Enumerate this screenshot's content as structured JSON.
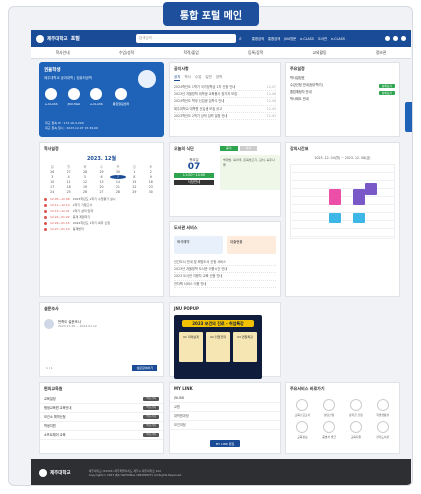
{
  "banner": {
    "title": "통합 포털 메인"
  },
  "topbar": {
    "logo": "제주대학교",
    "portal": "포털",
    "search_placeholder": "검색입력",
    "links": [
      "통합검색",
      "통합검색",
      "JNU영문",
      "e-CLASS",
      "도서관",
      "e-CLASS"
    ]
  },
  "menu": [
    "학사안내",
    "수업/성적",
    "학적/졸업",
    "등록/장학",
    "교외활동",
    "정보관"
  ],
  "profile": {
    "name": "권율학생",
    "dept": "제주대학교 공과대학 | 컴퓨터공학",
    "quick": [
      "e-CLASS",
      "JNU-Mail",
      "e-CLASS",
      "통합알림센터"
    ],
    "info": [
      "최근 접속 IP : 172.16.4.209",
      "최근 접속 일시 : 2023.12.07 15:39:06"
    ]
  },
  "notice": {
    "title": "공지사항",
    "tabs": [
      "공지",
      "학사",
      "수업",
      "일반",
      "장학"
    ],
    "items": [
      {
        "text": "2024학년도 1학기 국가장학금 1차 신청 안내",
        "date": "12-07"
      },
      {
        "text": "2023년 겨울방학 대학생 교육봉사 참가자 모집",
        "date": "12-06"
      },
      {
        "text": "2024학년도 학부 신입생 입학식 안내",
        "date": "12-06"
      },
      {
        "text": "제주대학교 대학원 신입생 모집 공고",
        "date": "12-05"
      },
      {
        "text": "2023학년도 2학기 성적 입력 일정 안내",
        "date": "12-05"
      }
    ]
  },
  "schedule": {
    "title": "주요일정",
    "items": [
      {
        "label": "학사일정표",
        "badge": ""
      },
      {
        "label": "수강신청 안내(정규학기)",
        "badge": "상세보기"
      },
      {
        "label": "졸업예정자 안내",
        "badge": "상세보기"
      },
      {
        "label": "학사제도 안내",
        "badge": ""
      }
    ]
  },
  "calendar": {
    "title": "학사일정",
    "month": "2023. 12월",
    "days": [
      "일",
      "월",
      "화",
      "수",
      "목",
      "금",
      "토"
    ],
    "dates": [
      "26",
      "27",
      "28",
      "29",
      "30",
      "1",
      "2",
      "3",
      "4",
      "5",
      "6",
      "7",
      "8",
      "9",
      "10",
      "11",
      "12",
      "13",
      "14",
      "15",
      "16",
      "17",
      "18",
      "19",
      "20",
      "21",
      "22",
      "23",
      "24",
      "25",
      "26",
      "27",
      "28",
      "29",
      "30"
    ],
    "today": "7",
    "events": [
      {
        "date": "12.05~12.08",
        "text": "2023학년도 2학기 수업평가 실시"
      },
      {
        "date": "12.11~12.14",
        "text": "2학기 기말고사"
      },
      {
        "date": "12.15~12.21",
        "text": "2학기 성적 입력"
      },
      {
        "date": "12.22~01.02",
        "text": "동계 계절학기"
      },
      {
        "date": "12.26~01.15",
        "text": "2024학년도 1학기 복학 신청"
      },
      {
        "date": "12.27~01.10",
        "text": "동계방학"
      }
    ]
  },
  "meal": {
    "title": "오늘의 식단",
    "tabs": [
      "중식",
      "석식"
    ],
    "day": "07",
    "weekday": "목요일",
    "time": "11:00~14:00",
    "menu": "백미밥, 북어국, 돈육불고기, 김치, 숙주나물",
    "button": "식당안내"
  },
  "library": {
    "title": "도서관 서비스",
    "cards": [
      "좌석예약",
      "대출현황"
    ],
    "items": [
      "신간도서 안내 및 희망도서 신청 서비스",
      "2023년 겨울방학 도서관 이용시간 안내",
      "2023 도서관 이용자 교육 신청 안내",
      "전자책 서비스 이용 안내"
    ]
  },
  "timetable": {
    "title": "강의시간표",
    "range": "2023. 12. 04(월) ~ 2023. 12. 08(금)"
  },
  "survey": {
    "title": "설문조사",
    "item": "만족도 설문조사",
    "period": "2023.11.28 ~ 2024.01.12",
    "pager": "1 / 1",
    "button": "설문참여하기"
  },
  "popup": {
    "title": "JNU POPUP",
    "headline": "2023 보건의 진로 - 취업특강",
    "cards": [
      "01 미래설계",
      "02 취업전략",
      "03 면접특강"
    ]
  },
  "quicklinks": {
    "title": "편의교육원",
    "items": [
      "교육일정",
      "평생교육원 교육안내",
      "보건소 예약신청",
      "학생지원",
      "소프트웨어 교육"
    ],
    "pill": "바로가기"
  },
  "mylink": {
    "title": "MY LINK",
    "items": [
      "JNUBB",
      "교원",
      "대학원과정",
      "보건과정"
    ],
    "button": "MY LINK 편집"
  },
  "services": {
    "title": "주요서비스 바로가기",
    "items": [
      "교육수요조사",
      "상담신청",
      "장학금 신청",
      "학생생활관",
      "교육정보",
      "증명서 발급",
      "교육지원",
      "전자도서관"
    ]
  },
  "footer": {
    "logo": "제주대학교",
    "lines": [
      "제주대학교 (63243) 제주특별자치도 제주시 제주대학로 102",
      "Copyright(c) 2023 JEJU NATIONAL UNIVERSITY. All Rights Reserved."
    ]
  },
  "colors": {
    "primary": "#1a4b96",
    "accent": "#1e63b8",
    "success": "#2ea44f"
  }
}
